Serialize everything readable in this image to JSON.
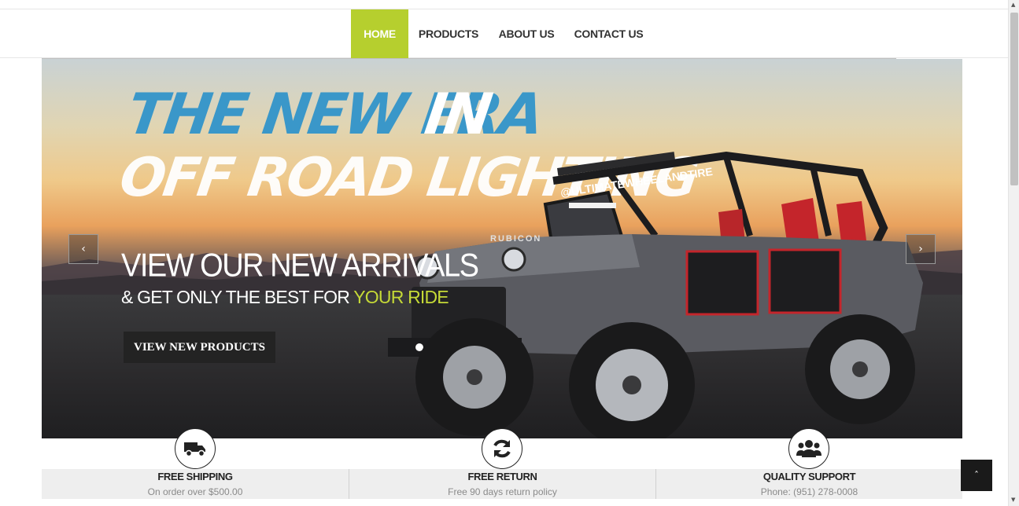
{
  "nav": {
    "items": [
      {
        "label": "HOME",
        "active": true
      },
      {
        "label": "PRODUCTS",
        "active": false
      },
      {
        "label": "ABOUT US",
        "active": false
      },
      {
        "label": "CONTACT US",
        "active": false
      }
    ]
  },
  "slider": {
    "headline_line1_part1": "THE NEW ERA",
    "headline_line1_part2": "IN",
    "headline_line2": "OFF ROAD LIGHTING",
    "title": "VIEW OUR NEW ARRIVALS",
    "subtitle_prefix": "& GET ONLY THE BEST FOR",
    "subtitle_accent": "YOUR RIDE",
    "button_label": "VIEW NEW PRODUCTS",
    "prev_arrow": "‹",
    "next_arrow": "›",
    "vehicle_badge": "RUBICON",
    "windshield_text": "@ULTIMATEWHEELANDTIRE"
  },
  "features": [
    {
      "title": "FREE SHIPPING",
      "description": "On order over $500.00",
      "icon": "truck-icon"
    },
    {
      "title": "FREE RETURN",
      "description": "Free 90 days return policy",
      "icon": "refresh-icon"
    },
    {
      "title": "QUALITY SUPPORT",
      "description": "Phone: (951) 278-0008",
      "icon": "users-icon"
    }
  ],
  "back_to_top": "ˆ",
  "colors": {
    "accent": "#b6cf2e",
    "headline_blue": "#3a97c9",
    "dark_button": "#232323",
    "feature_bg": "#eeeeee"
  }
}
